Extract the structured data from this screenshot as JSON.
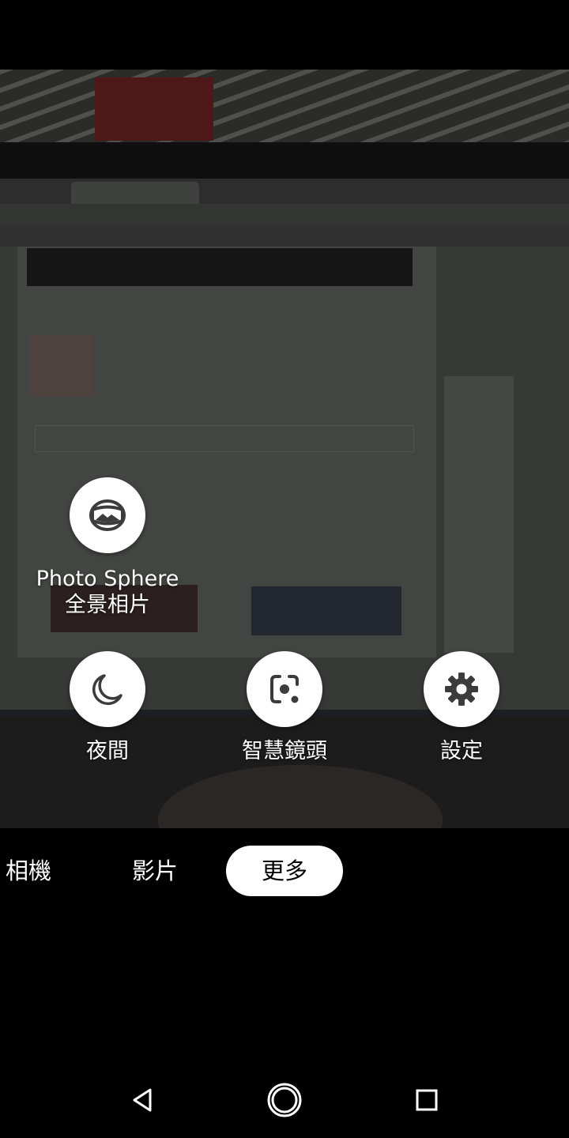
{
  "modes": {
    "photosphere": {
      "label": "Photo Sphere",
      "sublabel": "全景相片",
      "icon": "photo-sphere-icon"
    },
    "night": {
      "label": "夜間",
      "icon": "moon-icon"
    },
    "lens": {
      "label": "智慧鏡頭",
      "icon": "lens-icon"
    },
    "settings": {
      "label": "設定",
      "icon": "gear-icon"
    }
  },
  "tabs": {
    "camera": "相機",
    "video": "影片",
    "more": "更多",
    "selected": "更多"
  },
  "navbar": {
    "back_icon": "back-triangle-icon",
    "home_icon": "home-circle-icon",
    "recent_icon": "recents-square-icon"
  },
  "colors": {
    "background": "#000000",
    "button_fill": "#ffffff",
    "icon_color": "#3c3c3c",
    "text": "#ffffff"
  }
}
